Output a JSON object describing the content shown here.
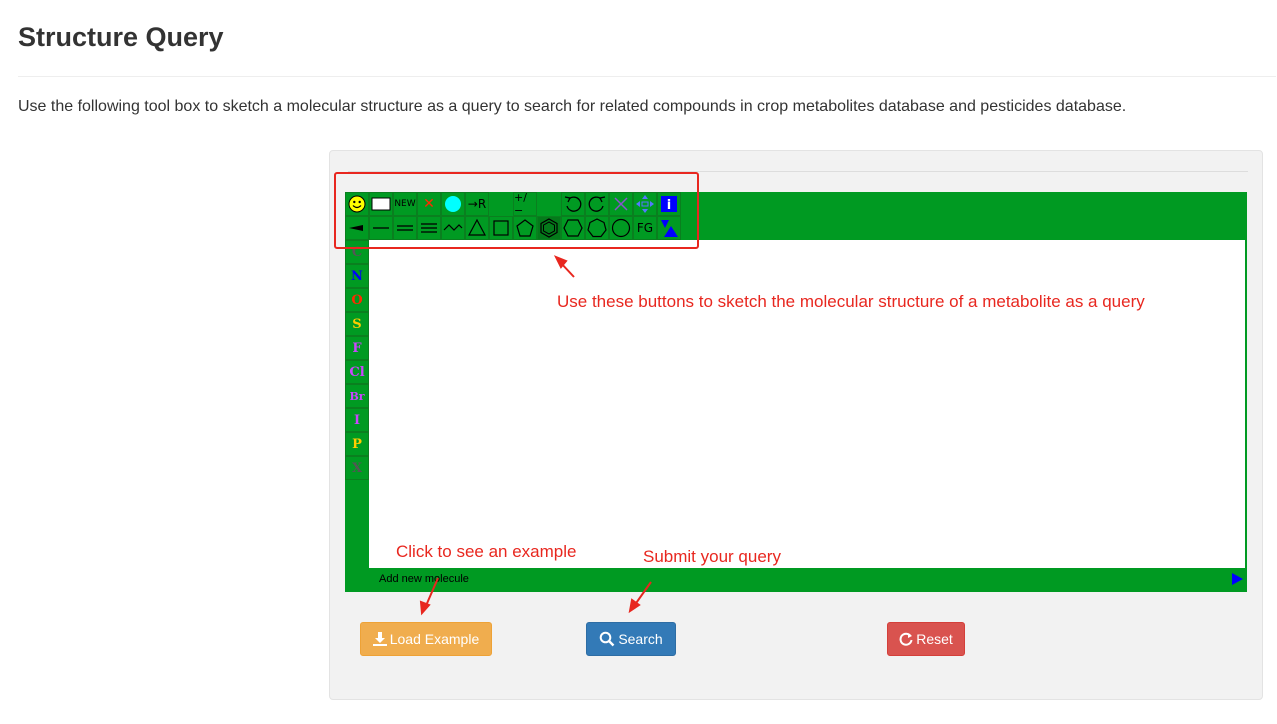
{
  "page": {
    "title": "Structure Query",
    "intro": "Use the following tool box to sketch a molecular structure as a query to search for related compounds in crop metabolites database and pesticides database."
  },
  "editor": {
    "toolbar_row1": [
      {
        "name": "smiley-icon",
        "label": ""
      },
      {
        "name": "blank-rect-icon",
        "label": ""
      },
      {
        "name": "new-button",
        "label": "NEW"
      },
      {
        "name": "delete-x-icon",
        "label": "✕"
      },
      {
        "name": "cyan-circle-icon",
        "label": ""
      },
      {
        "name": "r-group-button",
        "label": "→R"
      },
      {
        "name": "gap",
        "label": ""
      },
      {
        "name": "charge-button",
        "label": "+/−"
      },
      {
        "name": "gap",
        "label": ""
      },
      {
        "name": "undo-icon",
        "label": ""
      },
      {
        "name": "redo-icon",
        "label": ""
      },
      {
        "name": "erase-icon",
        "label": ""
      },
      {
        "name": "move-icon",
        "label": ""
      },
      {
        "name": "info-icon",
        "label": "i"
      }
    ],
    "toolbar_row2": [
      {
        "name": "wedge-bond-icon",
        "label": ""
      },
      {
        "name": "single-bond-icon",
        "label": ""
      },
      {
        "name": "double-bond-icon",
        "label": ""
      },
      {
        "name": "triple-bond-icon",
        "label": ""
      },
      {
        "name": "chain-icon",
        "label": ""
      },
      {
        "name": "triangle-ring-icon",
        "label": ""
      },
      {
        "name": "square-ring-icon",
        "label": ""
      },
      {
        "name": "pentagon-ring-icon",
        "label": ""
      },
      {
        "name": "benzene-ring-icon",
        "label": ""
      },
      {
        "name": "hexagon-ring-icon",
        "label": ""
      },
      {
        "name": "heptagon-ring-icon",
        "label": ""
      },
      {
        "name": "octagon-ring-icon",
        "label": ""
      },
      {
        "name": "fg-button",
        "label": "FG"
      },
      {
        "name": "template-icon",
        "label": ""
      }
    ],
    "elements": [
      {
        "symbol": "C",
        "color": "#555555"
      },
      {
        "symbol": "N",
        "color": "#0000ff"
      },
      {
        "symbol": "O",
        "color": "#ff2a00"
      },
      {
        "symbol": "S",
        "color": "#ffcc00"
      },
      {
        "symbol": "F",
        "color": "#cc44ff"
      },
      {
        "symbol": "Cl",
        "color": "#cc44ff"
      },
      {
        "symbol": "Br",
        "color": "#cc44ff"
      },
      {
        "symbol": "I",
        "color": "#cc44ff"
      },
      {
        "symbol": "P",
        "color": "#ffcc00"
      },
      {
        "symbol": "X",
        "color": "#555555"
      }
    ],
    "status": "Add new molecule"
  },
  "annotations": {
    "toolbar_note": "Use these buttons to sketch the molecular structure of a metabolite as a query",
    "example_note": "Click to see an example",
    "submit_note": "Submit your query"
  },
  "buttons": {
    "load_example": "Load Example",
    "search": "Search",
    "reset": "Reset"
  },
  "colors": {
    "editor_green": "#009a22",
    "annotation_red": "#e8271f",
    "load_orange": "#f0ad4e",
    "search_blue": "#337ab7",
    "reset_red": "#d9534f"
  }
}
